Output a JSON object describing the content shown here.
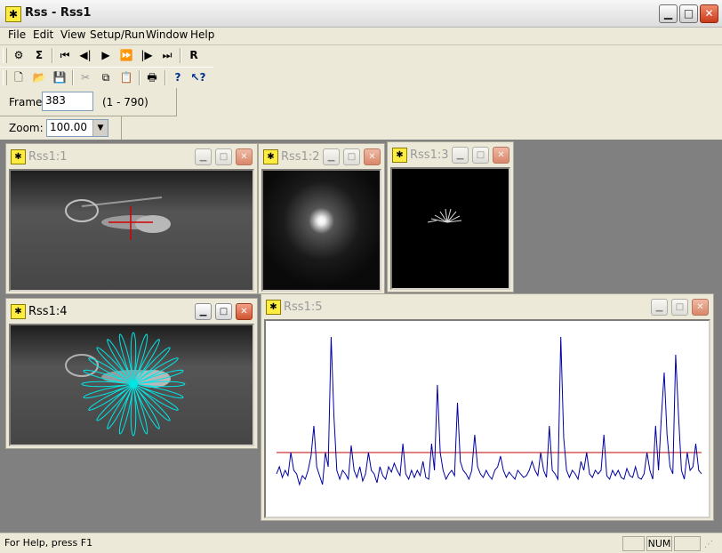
{
  "window": {
    "title": "Rss - Rss1",
    "icon": "app-icon"
  },
  "menu": [
    "File",
    "Edit",
    "View",
    "Setup/Run",
    "Window",
    "Help"
  ],
  "toolbar1": {
    "r_label": "R"
  },
  "frame": {
    "label": "Frame",
    "value": "383",
    "range": "(1 - 790)"
  },
  "zoom": {
    "label": "Zoom:",
    "value": "100.00"
  },
  "children": {
    "c1": {
      "title": "Rss1:1"
    },
    "c2": {
      "title": "Rss1:2"
    },
    "c3": {
      "title": "Rss1:3"
    },
    "c4": {
      "title": "Rss1:4"
    },
    "c5": {
      "title": "Rss1:5"
    }
  },
  "status": {
    "help": "For Help, press F1",
    "num": "NUM"
  },
  "colors": {
    "plot_line": "#0000a0",
    "threshold": "#c00000",
    "overlay": "#00e5e5",
    "crosshair": "#d00000"
  },
  "chart_data": {
    "type": "line",
    "series": [
      {
        "values": [
          0.18,
          0.22,
          0.16,
          0.2,
          0.17,
          0.3,
          0.2,
          0.18,
          0.12,
          0.17,
          0.15,
          0.2,
          0.28,
          0.45,
          0.22,
          0.17,
          0.12,
          0.3,
          0.22,
          0.95,
          0.5,
          0.2,
          0.15,
          0.2,
          0.18,
          0.15,
          0.34,
          0.2,
          0.16,
          0.22,
          0.14,
          0.18,
          0.3,
          0.2,
          0.18,
          0.13,
          0.22,
          0.17,
          0.15,
          0.22,
          0.19,
          0.24,
          0.2,
          0.17,
          0.35,
          0.18,
          0.15,
          0.2,
          0.16,
          0.2,
          0.17,
          0.25,
          0.16,
          0.15,
          0.35,
          0.2,
          0.68,
          0.3,
          0.2,
          0.15,
          0.18,
          0.2,
          0.17,
          0.58,
          0.25,
          0.2,
          0.18,
          0.15,
          0.2,
          0.4,
          0.22,
          0.18,
          0.16,
          0.2,
          0.17,
          0.15,
          0.2,
          0.22,
          0.28,
          0.2,
          0.16,
          0.19,
          0.17,
          0.15,
          0.2,
          0.18,
          0.16,
          0.17,
          0.2,
          0.25,
          0.2,
          0.17,
          0.3,
          0.2,
          0.16,
          0.45,
          0.2,
          0.18,
          0.15,
          0.95,
          0.38,
          0.2,
          0.16,
          0.2,
          0.18,
          0.15,
          0.25,
          0.2,
          0.3,
          0.18,
          0.16,
          0.2,
          0.18,
          0.2,
          0.4,
          0.17,
          0.15,
          0.2,
          0.17,
          0.2,
          0.16,
          0.15,
          0.21,
          0.17,
          0.16,
          0.22,
          0.16,
          0.15,
          0.18,
          0.3,
          0.2,
          0.15,
          0.45,
          0.2,
          0.5,
          0.75,
          0.4,
          0.22,
          0.18,
          0.85,
          0.5,
          0.2,
          0.15,
          0.3,
          0.2,
          0.22,
          0.35,
          0.2,
          0.18
        ]
      }
    ],
    "threshold": 0.3,
    "ylim": [
      0,
      1
    ]
  }
}
